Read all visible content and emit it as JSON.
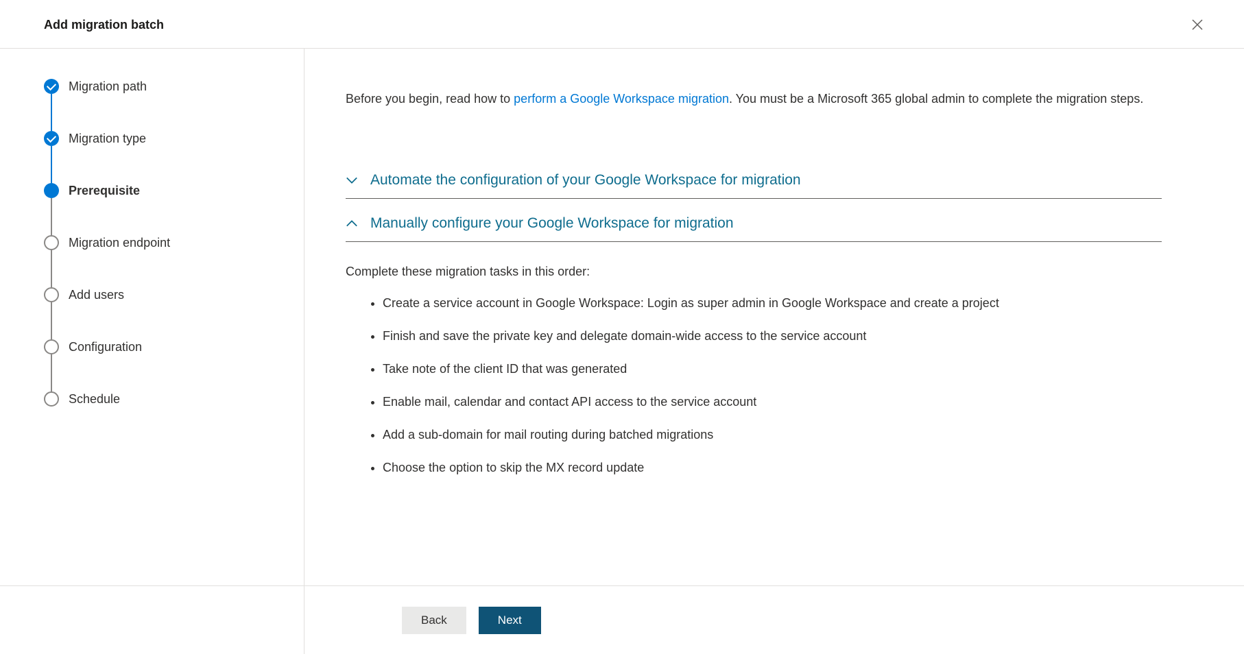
{
  "header": {
    "title": "Add migration batch"
  },
  "steps": [
    {
      "label": "Migration path",
      "state": "completed"
    },
    {
      "label": "Migration type",
      "state": "completed"
    },
    {
      "label": "Prerequisite",
      "state": "active"
    },
    {
      "label": "Migration endpoint",
      "state": "pending"
    },
    {
      "label": "Add users",
      "state": "pending"
    },
    {
      "label": "Configuration",
      "state": "pending"
    },
    {
      "label": "Schedule",
      "state": "pending"
    }
  ],
  "main": {
    "intro_before": "Before you begin, read how to ",
    "intro_link": "perform a Google Workspace migration",
    "intro_after": ". You must be a Microsoft 365 global admin to complete the migration steps.",
    "accordion1_title": "Automate the configuration of your Google Workspace for migration",
    "accordion2_title": "Manually configure your Google Workspace for migration",
    "tasks_intro": "Complete these migration tasks in this order:",
    "tasks": [
      "Create a service account in Google Workspace: Login as super admin in Google Workspace and create a project",
      "Finish and save the private key and delegate domain-wide access to the service account",
      "Take note of the client ID that was generated",
      "Enable mail, calendar and contact API access to the service account",
      "Add a sub-domain for mail routing during batched migrations",
      "Choose the option to skip the MX record update"
    ]
  },
  "footer": {
    "back": "Back",
    "next": "Next"
  }
}
